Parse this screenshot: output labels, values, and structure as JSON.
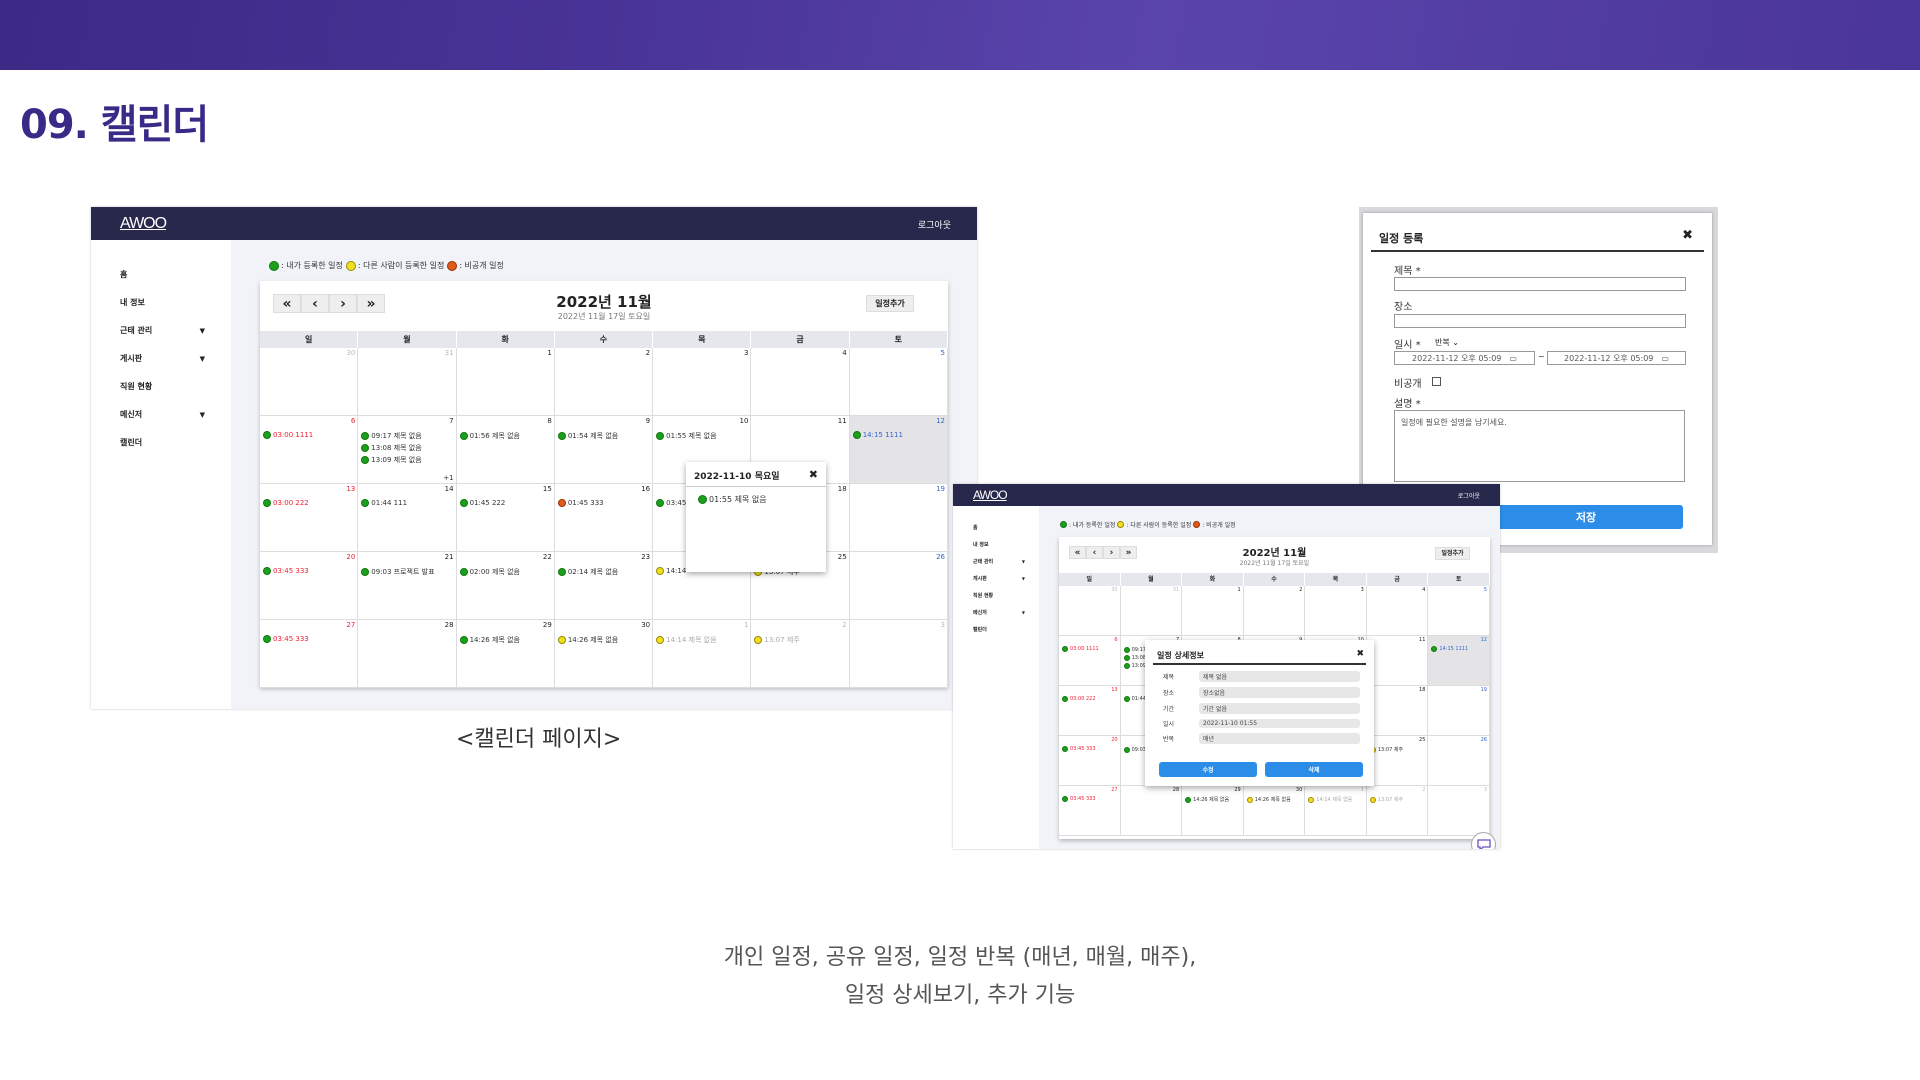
{
  "slide": {
    "title": "09. 캘린더",
    "caption": "<캘린더 페이지>",
    "description_line1": "개인 일정, 공유 일정,  일정 반복 (매년, 매월, 매주),",
    "description_line2": "일정 상세보기, 추가 기능"
  },
  "app": {
    "logo": "AWOO",
    "logout": "로그아웃"
  },
  "sidebar": {
    "items": [
      {
        "label": "홈",
        "caret": ""
      },
      {
        "label": "내 정보",
        "caret": ""
      },
      {
        "label": "근태 관리",
        "caret": "▼"
      },
      {
        "label": "게시판",
        "caret": "▼"
      },
      {
        "label": "직원 현황",
        "caret": ""
      },
      {
        "label": "메신저",
        "caret": "▼"
      },
      {
        "label": "캘린더",
        "caret": ""
      }
    ]
  },
  "legend": {
    "mine": ": 내가 등록한 일정",
    "others": ": 다른 사람이 등록한 일정",
    "private": ": 비공개 일정"
  },
  "calendar": {
    "title": "2022년 11월",
    "subtitle": "2022년 11월 17일 토요일",
    "add_button": "일정추가",
    "nav": [
      "«",
      "‹",
      "›",
      "»"
    ],
    "weekdays": [
      "일",
      "월",
      "화",
      "수",
      "목",
      "금",
      "토"
    ],
    "weeks": [
      [
        {
          "d": "30",
          "o": true
        },
        {
          "d": "31",
          "o": true
        },
        {
          "d": "1"
        },
        {
          "d": "2"
        },
        {
          "d": "3"
        },
        {
          "d": "4"
        },
        {
          "d": "5"
        }
      ],
      [
        {
          "d": "6",
          "ev": [
            [
              "g",
              "03:00 1111",
              "red"
            ]
          ]
        },
        {
          "d": "7",
          "ev": [
            [
              "g",
              "09:17 제목 없음",
              ""
            ],
            [
              "g",
              "13:08 제목 없음",
              ""
            ],
            [
              "g",
              "13:09 제목 없음",
              ""
            ]
          ],
          "more": "+1"
        },
        {
          "d": "8",
          "ev": [
            [
              "g",
              "01:56 제목 없음",
              ""
            ]
          ]
        },
        {
          "d": "9",
          "ev": [
            [
              "g",
              "01:54 제목 없음",
              ""
            ]
          ]
        },
        {
          "d": "10",
          "ev": [
            [
              "g",
              "01:55 제목 없음",
              ""
            ]
          ]
        },
        {
          "d": "11"
        },
        {
          "d": "12",
          "hl": true,
          "ev": [
            [
              "g",
              "14:15 1111",
              "blue"
            ]
          ]
        }
      ],
      [
        {
          "d": "13",
          "ev": [
            [
              "g",
              "03:00 222",
              "red"
            ]
          ]
        },
        {
          "d": "14",
          "ev": [
            [
              "g",
              "01:44 111",
              ""
            ]
          ]
        },
        {
          "d": "15",
          "ev": [
            [
              "g",
              "01:45 222",
              ""
            ]
          ]
        },
        {
          "d": "16",
          "ev": [
            [
              "r",
              "01:45 333",
              ""
            ]
          ]
        },
        {
          "d": "17",
          "ev": [
            [
              "g",
              "03:45",
              ""
            ]
          ]
        },
        {
          "d": "18"
        },
        {
          "d": "19"
        }
      ],
      [
        {
          "d": "20",
          "ev": [
            [
              "g",
              "03:45 333",
              "red"
            ]
          ]
        },
        {
          "d": "21",
          "ev": [
            [
              "g",
              "09:03 프로젝트 발표",
              ""
            ]
          ]
        },
        {
          "d": "22",
          "ev": [
            [
              "g",
              "02:00 제목 없음",
              ""
            ]
          ]
        },
        {
          "d": "23",
          "ev": [
            [
              "g",
              "02:14 제목 없음",
              ""
            ]
          ]
        },
        {
          "d": "24",
          "ev": [
            [
              "y",
              "14:14",
              ""
            ]
          ]
        },
        {
          "d": "25",
          "ev": [
            [
              "y",
              "13:07 제주",
              ""
            ]
          ]
        },
        {
          "d": "26"
        }
      ],
      [
        {
          "d": "27",
          "ev": [
            [
              "g",
              "03:45 333",
              "red"
            ]
          ]
        },
        {
          "d": "28"
        },
        {
          "d": "29",
          "ev": [
            [
              "g",
              "14:26 제목 없음",
              ""
            ]
          ]
        },
        {
          "d": "30",
          "ev": [
            [
              "y",
              "14:26 제목 없음",
              ""
            ]
          ]
        },
        {
          "d": "1",
          "o": true,
          "ev": [
            [
              "y",
              "14:14 제목 없음",
              "dim"
            ]
          ]
        },
        {
          "d": "2",
          "o": true,
          "ev": [
            [
              "y",
              "13:07 제주",
              "dim"
            ]
          ]
        },
        {
          "d": "3",
          "o": true
        }
      ]
    ]
  },
  "day_popup": {
    "title": "2022-11-10 목요일",
    "close": "✖",
    "event": "01:55 제목 없음"
  },
  "register_modal": {
    "title": "일정 등록",
    "close": "✖",
    "title_label": "제목 *",
    "place_label": "장소",
    "date_label": "일시 *",
    "repeat_value": "반복",
    "start": "2022-11-12 오후 05:09",
    "tilde": "~",
    "end": "2022-11-12 오후 05:09",
    "private_label": "비공개",
    "desc_label": "설명 *",
    "desc_placeholder": "일정에 필요한 설명을 남기세요.",
    "save": "저장"
  },
  "detail_modal": {
    "title": "일정 상세정보",
    "close": "✖",
    "rows": [
      {
        "k": "제목",
        "v": "제목 없음"
      },
      {
        "k": "장소",
        "v": "장소없음"
      },
      {
        "k": "기간",
        "v": "기간 없음"
      },
      {
        "k": "일시",
        "v": "2022-11-10 01:55"
      },
      {
        "k": "반복",
        "v": "매년"
      }
    ],
    "edit": "수정",
    "delete": "삭제"
  }
}
